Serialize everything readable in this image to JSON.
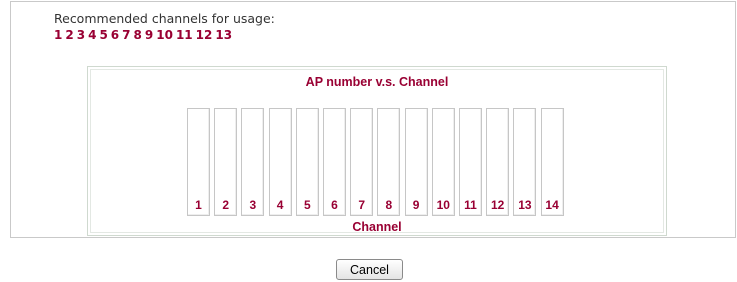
{
  "recommended": {
    "label": "Recommended channels for usage:",
    "channels": [
      "1",
      "2",
      "3",
      "4",
      "5",
      "6",
      "7",
      "8",
      "9",
      "10",
      "11",
      "12",
      "13"
    ]
  },
  "chart_data": {
    "type": "bar",
    "title": "AP number v.s. Channel",
    "xlabel": "Channel",
    "categories": [
      "1",
      "2",
      "3",
      "4",
      "5",
      "6",
      "7",
      "8",
      "9",
      "10",
      "11",
      "12",
      "13",
      "14"
    ],
    "values": [
      0,
      0,
      0,
      0,
      0,
      0,
      0,
      0,
      0,
      0,
      0,
      0,
      0,
      0
    ]
  },
  "buttons": {
    "cancel_label": "Cancel"
  },
  "colors": {
    "accent": "#990033",
    "panel_border": "#c9c9c9"
  }
}
